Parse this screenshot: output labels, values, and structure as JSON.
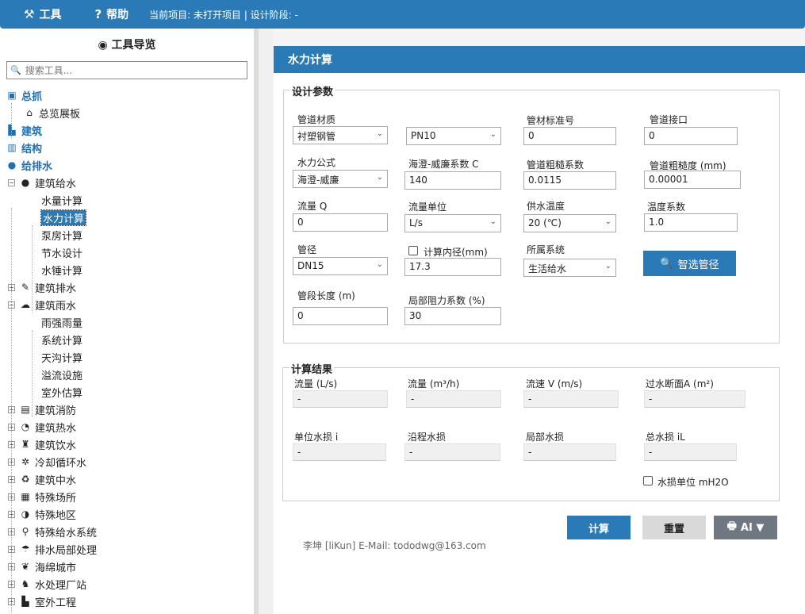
{
  "topbar": {
    "tools_label": "工具",
    "help_label": "帮助",
    "status": "当前项目: 未打开项目 | 设计阶段: -"
  },
  "sidebar": {
    "title": "工具导览",
    "search_placeholder": "搜索工具...",
    "tree": [
      {
        "label": "总抓",
        "type": "cat"
      },
      {
        "label": "总览展板",
        "type": "leaf"
      },
      {
        "label": "建筑",
        "type": "cat"
      },
      {
        "label": "结构",
        "type": "cat"
      },
      {
        "label": "给排水",
        "type": "cat"
      },
      {
        "label": "建筑给水",
        "type": "group"
      },
      {
        "label": "水量计算",
        "type": "leaf"
      },
      {
        "label": "水力计算",
        "type": "leaf",
        "selected": true
      },
      {
        "label": "泵房计算",
        "type": "leaf"
      },
      {
        "label": "节水设计",
        "type": "leaf"
      },
      {
        "label": "水锤计算",
        "type": "leaf"
      },
      {
        "label": "建筑排水",
        "type": "group"
      },
      {
        "label": "建筑雨水",
        "type": "group"
      },
      {
        "label": "雨强雨量",
        "type": "leaf"
      },
      {
        "label": "系统计算",
        "type": "leaf"
      },
      {
        "label": "天沟计算",
        "type": "leaf"
      },
      {
        "label": "溢流设施",
        "type": "leaf"
      },
      {
        "label": "室外估算",
        "type": "leaf"
      },
      {
        "label": "建筑消防",
        "type": "group"
      },
      {
        "label": "建筑热水",
        "type": "group"
      },
      {
        "label": "建筑饮水",
        "type": "group"
      },
      {
        "label": "冷却循环水",
        "type": "group"
      },
      {
        "label": "建筑中水",
        "type": "group"
      },
      {
        "label": "特殊场所",
        "type": "group"
      },
      {
        "label": "特殊地区",
        "type": "group"
      },
      {
        "label": "特殊给水系统",
        "type": "group"
      },
      {
        "label": "排水局部处理",
        "type": "group"
      },
      {
        "label": "海绵城市",
        "type": "group"
      },
      {
        "label": "水处理厂站",
        "type": "group"
      },
      {
        "label": "室外工程",
        "type": "group"
      }
    ]
  },
  "main": {
    "title": "水力计算",
    "design_params": {
      "legend": "设计参数",
      "pipe_material_label": "管道材质",
      "pipe_material_value": "衬塑钢管",
      "pressure_value": "PN10",
      "pipe_standard_label": "管材标准号",
      "pipe_standard_value": "0",
      "pipe_joint_label": "管道接口",
      "pipe_joint_value": "0",
      "formula_label": "水力公式",
      "formula_value": "海澄-威廉",
      "hw_coef_label": "海澄-威廉系数 C",
      "hw_coef_value": "140",
      "roughness_coef_label": "管道粗糙系数",
      "roughness_coef_value": "0.0115",
      "roughness_mm_label": "管道粗糙度 (mm)",
      "roughness_mm_value": "0.00001",
      "flow_label": "流量 Q",
      "flow_value": "0",
      "flow_unit_label": "流量单位",
      "flow_unit_value": "L/s",
      "temp_label": "供水温度",
      "temp_value": "20 (℃)",
      "temp_coef_label": "温度系数",
      "temp_coef_value": "1.0",
      "diameter_label": "管径",
      "diameter_value": "DN15",
      "inner_diam_label": "计算内径(mm)",
      "inner_diam_value": "17.3",
      "system_label": "所属系统",
      "system_value": "生活给水",
      "smart_pipe_button": "智选管径",
      "length_label": "管段长度 (m)",
      "length_value": "0",
      "local_loss_label": "局部阻力系数 (%)",
      "local_loss_value": "30"
    },
    "results": {
      "legend": "计算结果",
      "flow_ls_label": "流量 (L/s)",
      "flow_ls_value": "-",
      "flow_m3h_label": "流量 (m³/h)",
      "flow_m3h_value": "-",
      "velocity_label": "流速 V (m/s)",
      "velocity_value": "-",
      "area_label": "过水断面A (m²)",
      "area_value": "-",
      "unit_loss_label": "单位水损 i",
      "unit_loss_value": "-",
      "path_loss_label": "沿程水损",
      "path_loss_value": "-",
      "local_loss_label": "局部水损",
      "local_loss_value": "-",
      "total_loss_label": "总水损 iL",
      "total_loss_value": "-",
      "unit_mh2o_label": "水损单位 mH2O"
    },
    "buttons": {
      "calc": "计算",
      "reset": "重置",
      "ai": "AI ▼"
    },
    "footer": "李坤 [liKun] E-Mail: tododwg@163.com"
  }
}
